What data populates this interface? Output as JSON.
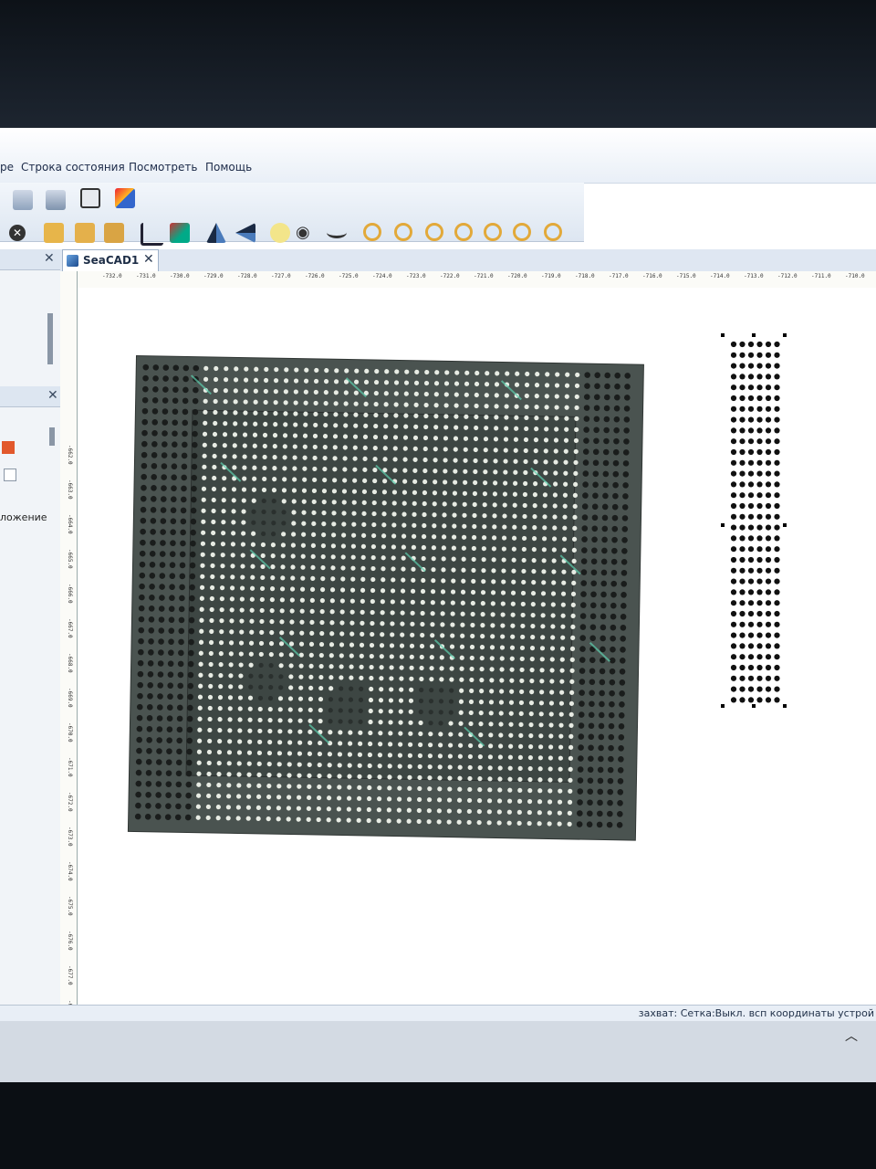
{
  "menu": {
    "items": [
      "ре",
      "Строка состояния",
      "Посмотреть",
      "Помощь"
    ]
  },
  "toolbar": {
    "row1_icons": [
      "copy-icon",
      "paste-icon",
      "capture-icon",
      "layers-icon"
    ],
    "row2_icons": [
      "cancel-icon",
      "lock-icon",
      "unlock-icon",
      "lock-all-icon",
      "crop-icon",
      "move-icon",
      "mirror-horizontal-icon",
      "mirror-vertical-icon",
      "show-icon",
      "hide-icon",
      "zoom-icon",
      "zoom-fit-icon",
      "zoom-in-icon",
      "zoom-out-icon",
      "zoom-actual-icon",
      "zoom-window-icon",
      "zoom-extents-icon"
    ]
  },
  "left_panel": {
    "label": "ложение"
  },
  "document": {
    "tab_label": "SeaCAD1"
  },
  "rulers": {
    "horizontal": [
      "-732.0",
      "-731.0",
      "-730.0",
      "-729.0",
      "-728.0",
      "-727.0",
      "-726.0",
      "-725.0",
      "-724.0",
      "-723.0",
      "-722.0",
      "-721.0",
      "-720.0",
      "-719.0",
      "-718.0",
      "-717.0",
      "-716.0",
      "-715.0",
      "-714.0",
      "-713.0",
      "-712.0",
      "-711.0",
      "-710.0"
    ],
    "vertical": [
      "-662.0",
      "-663.0",
      "-664.0",
      "-665.0",
      "-666.0",
      "-667.0",
      "-668.0",
      "-669.0",
      "-670.0",
      "-671.0",
      "-672.0",
      "-673.0",
      "-674.0",
      "-675.0",
      "-676.0",
      "-677.0",
      "-678.0",
      "-679.0",
      "-680.0",
      "-681.0",
      "-682.0"
    ]
  },
  "status": {
    "text": "захват: Сетка:Выкл. всп координаты устрой"
  },
  "colors": {
    "chip_ball": "#e8ece4",
    "chip_dark_ball": "#1a1d1c",
    "chip_trace": "#5fcfae",
    "rail_ball": "#111111"
  }
}
